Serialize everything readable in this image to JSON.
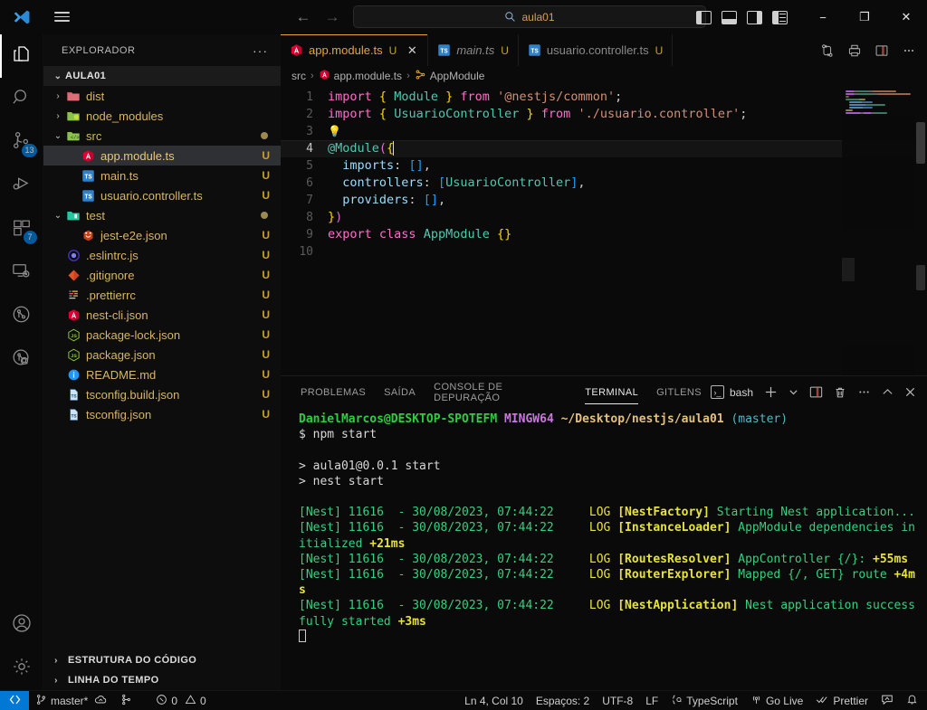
{
  "titlebar": {
    "search_value": "aula01",
    "search_icon": "search-icon",
    "back_icon": "arrow-left-icon",
    "forward_icon": "arrow-right-icon",
    "toggle_primary_sidebar": "layout-sidebar-left-icon",
    "toggle_panel": "layout-panel-icon",
    "toggle_secondary_sidebar": "layout-sidebar-right-icon",
    "customize_layout": "layout-grid-icon",
    "minimize": "−",
    "maximize": "❐",
    "close": "✕"
  },
  "activitybar": {
    "items": [
      {
        "name": "explorer",
        "icon": "files-icon",
        "badge": ""
      },
      {
        "name": "search",
        "icon": "search-icon",
        "badge": ""
      },
      {
        "name": "source-control",
        "icon": "source-control-icon",
        "badge": "13"
      },
      {
        "name": "run-and-debug",
        "icon": "run-debug-icon",
        "badge": ""
      },
      {
        "name": "extensions",
        "icon": "extensions-icon",
        "badge": "7"
      },
      {
        "name": "remote-explorer",
        "icon": "remote-explorer-icon",
        "badge": ""
      },
      {
        "name": "gitlens",
        "icon": "gitlens-icon",
        "badge": ""
      },
      {
        "name": "gitlens-inspect",
        "icon": "gitlens-inspect-icon",
        "badge": ""
      }
    ],
    "accounts_icon": "account-icon",
    "settings_icon": "gear-icon"
  },
  "sidebar": {
    "title": "EXPLORADOR",
    "more_actions": "···",
    "root": {
      "label": "AULA01",
      "expanded": true
    },
    "tree": [
      {
        "label": "dist",
        "icon": "folder-dist",
        "indent": 1,
        "type": "folder",
        "expanded": false,
        "status": ""
      },
      {
        "label": "node_modules",
        "icon": "folder-node",
        "indent": 1,
        "type": "folder",
        "expanded": false,
        "status": ""
      },
      {
        "label": "src",
        "icon": "folder-src",
        "indent": 1,
        "type": "folder",
        "expanded": true,
        "status": "dot"
      },
      {
        "label": "app.module.ts",
        "icon": "file-nest",
        "indent": 2,
        "type": "file",
        "status": "U",
        "selected": true
      },
      {
        "label": "main.ts",
        "icon": "file-ts",
        "indent": 2,
        "type": "file",
        "status": "U"
      },
      {
        "label": "usuario.controller.ts",
        "icon": "file-ts",
        "indent": 2,
        "type": "file",
        "status": "U"
      },
      {
        "label": "test",
        "icon": "folder-test",
        "indent": 1,
        "type": "folder",
        "expanded": true,
        "status": "dot"
      },
      {
        "label": "jest-e2e.json",
        "icon": "file-jest",
        "indent": 2,
        "type": "file",
        "status": "U"
      },
      {
        "label": ".eslintrc.js",
        "icon": "file-eslint",
        "indent": 1,
        "type": "file",
        "status": "U"
      },
      {
        "label": ".gitignore",
        "icon": "file-git",
        "indent": 1,
        "type": "file",
        "status": "U"
      },
      {
        "label": ".prettierrc",
        "icon": "file-prettier",
        "indent": 1,
        "type": "file",
        "status": "U"
      },
      {
        "label": "nest-cli.json",
        "icon": "file-nest",
        "indent": 1,
        "type": "file",
        "status": "U"
      },
      {
        "label": "package-lock.json",
        "icon": "file-npm",
        "indent": 1,
        "type": "file",
        "status": "U"
      },
      {
        "label": "package.json",
        "icon": "file-npm",
        "indent": 1,
        "type": "file",
        "status": "U"
      },
      {
        "label": "README.md",
        "icon": "file-readme",
        "indent": 1,
        "type": "file",
        "status": "U"
      },
      {
        "label": "tsconfig.build.json",
        "icon": "file-tsconfig",
        "indent": 1,
        "type": "file",
        "status": "U"
      },
      {
        "label": "tsconfig.json",
        "icon": "file-tsconfig",
        "indent": 1,
        "type": "file",
        "status": "U"
      }
    ],
    "sections": [
      {
        "label": "ESTRUTURA DO CÓDIGO",
        "expanded": false
      },
      {
        "label": "LINHA DO TEMPO",
        "expanded": false
      }
    ]
  },
  "editor": {
    "tabs": [
      {
        "label": "app.module.ts",
        "icon": "file-nest",
        "status": "U",
        "active": true,
        "italic": false,
        "closable": true
      },
      {
        "label": "main.ts",
        "icon": "file-ts",
        "status": "U",
        "active": false,
        "italic": true,
        "closable": false
      },
      {
        "label": "usuario.controller.ts",
        "icon": "file-ts",
        "status": "U",
        "active": false,
        "italic": false,
        "closable": false
      }
    ],
    "tab_close_glyph": "✕",
    "actions": [
      {
        "name": "split-sync-icon",
        "glyph": "compare"
      },
      {
        "name": "print-icon",
        "glyph": "print"
      },
      {
        "name": "split-editor-icon",
        "glyph": "split"
      },
      {
        "name": "more-actions-icon",
        "glyph": "···"
      }
    ],
    "breadcrumb": [
      {
        "label": "src",
        "icon": ""
      },
      {
        "label": "app.module.ts",
        "icon": "file-nest"
      },
      {
        "label": "AppModule",
        "icon": "symbol-class"
      }
    ],
    "breadcrumb_separator": "›",
    "lines": [
      {
        "n": "1",
        "current": false
      },
      {
        "n": "2",
        "current": false
      },
      {
        "n": "3",
        "current": false
      },
      {
        "n": "4",
        "current": true
      },
      {
        "n": "5",
        "current": false
      },
      {
        "n": "6",
        "current": false
      },
      {
        "n": "7",
        "current": false
      },
      {
        "n": "8",
        "current": false
      },
      {
        "n": "9",
        "current": false
      },
      {
        "n": "10",
        "current": false
      }
    ],
    "code_text": [
      "import { Module } from '@nestjs/common';",
      "import { UsuarioController } from './usuario.controller';",
      "",
      "@Module({",
      "  imports: [],",
      "  controllers: [UsuarioController],",
      "  providers: [],",
      "})",
      "export class AppModule {}",
      ""
    ]
  },
  "panel": {
    "tabs": [
      {
        "label": "PROBLEMAS",
        "active": false
      },
      {
        "label": "SAÍDA",
        "active": false
      },
      {
        "label": "CONSOLE DE DEPURAÇÃO",
        "active": false
      },
      {
        "label": "TERMINAL",
        "active": true
      },
      {
        "label": "GITLENS",
        "active": false
      }
    ],
    "shell_label": "bash",
    "shell_icon": "terminal-icon",
    "actions": [
      {
        "name": "new-terminal-icon",
        "glyph": "+"
      },
      {
        "name": "terminal-dropdown-icon",
        "glyph": "⌄"
      },
      {
        "name": "split-terminal-icon",
        "glyph": "split"
      },
      {
        "name": "kill-terminal-icon",
        "glyph": "trash"
      },
      {
        "name": "panel-more-icon",
        "glyph": "···"
      },
      {
        "name": "maximize-panel-icon",
        "glyph": "^"
      },
      {
        "name": "close-panel-icon",
        "glyph": "✕"
      }
    ],
    "terminal": {
      "prompt_user": "DanielMarcos@DESKTOP-SPOTEFM",
      "prompt_shell": "MINGW64",
      "prompt_path": "~/Desktop/nestjs/aula01",
      "prompt_branch": "(master)",
      "command": "$ npm start",
      "lines": [
        {
          "text": "> aula01@0.0.1 start",
          "color": "white"
        },
        {
          "text": "> nest start",
          "color": "white"
        },
        {
          "text": "",
          "color": "white"
        }
      ],
      "logs": [
        {
          "prefix": "[Nest] 11616  - 30/08/2023, 07:44:22",
          "level": "LOG",
          "context": "[NestFactory]",
          "message": "Starting Nest application..."
        },
        {
          "prefix": "[Nest] 11616  - 30/08/2023, 07:44:22",
          "level": "LOG",
          "context": "[InstanceLoader]",
          "message": "AppModule dependencies initialized",
          "timing": "+21ms"
        },
        {
          "prefix": "[Nest] 11616  - 30/08/2023, 07:44:22",
          "level": "LOG",
          "context": "[RoutesResolver]",
          "message": "AppController {/}:",
          "timing": "+55ms"
        },
        {
          "prefix": "[Nest] 11616  - 30/08/2023, 07:44:22",
          "level": "LOG",
          "context": "[RouterExplorer]",
          "message": "Mapped {/, GET} route",
          "timing": "+4ms"
        },
        {
          "prefix": "[Nest] 11616  - 30/08/2023, 07:44:22",
          "level": "LOG",
          "context": "[NestApplication]",
          "message": "Nest application successfully started",
          "timing": "+3ms"
        }
      ]
    }
  },
  "statusbar": {
    "remote_icon": "remote-window-icon",
    "branch": "master*",
    "branch_icon": "source-control-icon",
    "sync_icon": "sync-cloud-icon",
    "gitlens_icon": "gitlens-status-icon",
    "errors": "0",
    "error_icon": "error-icon",
    "warnings": "0",
    "warning_icon": "warning-icon",
    "position": "Ln 4, Col 10",
    "indentation": "Espaços: 2",
    "encoding": "UTF-8",
    "eol": "LF",
    "language": "TypeScript",
    "language_icon": "typescript-icon",
    "golive": "Go Live",
    "golive_icon": "broadcast-icon",
    "prettier": "Prettier",
    "prettier_icon": "checkmarks-icon",
    "feedback_icon": "feedback-icon",
    "bell_icon": "bell-icon"
  },
  "colors": {
    "accent": "#0078d4",
    "tab_active": "#e8a33d",
    "modified_u": "#c9a227",
    "terminal_green": "#35d07f",
    "terminal_yellow": "#e8e337"
  }
}
